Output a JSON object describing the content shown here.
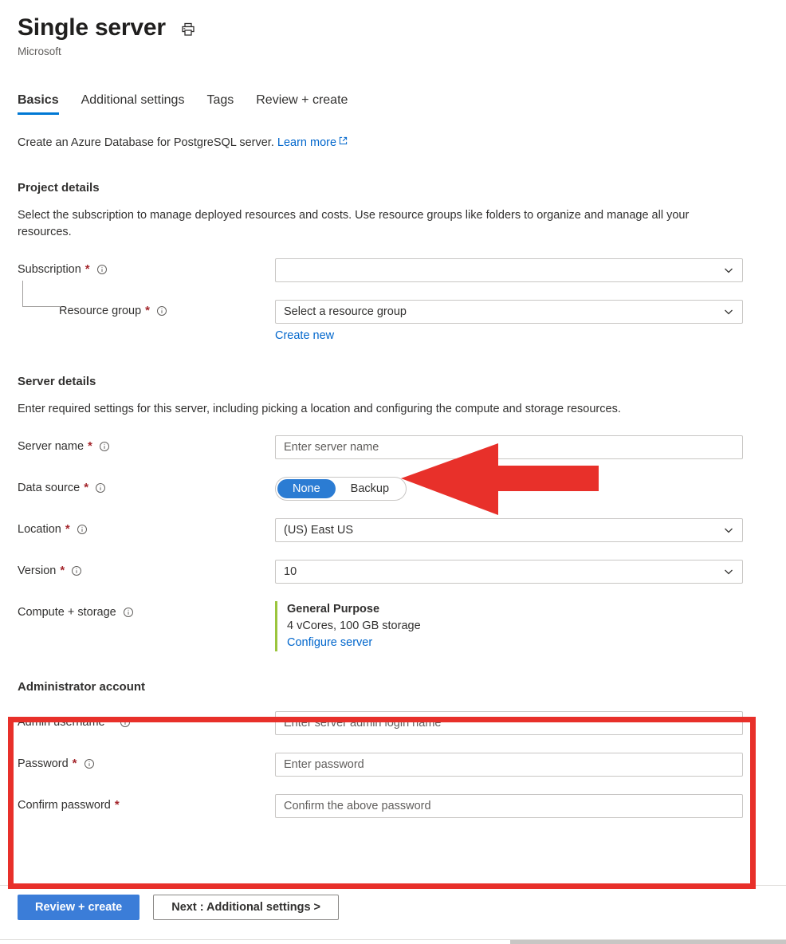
{
  "header": {
    "title": "Single server",
    "publisher": "Microsoft",
    "print_icon": "printer-icon"
  },
  "tabs": [
    {
      "label": "Basics",
      "active": true
    },
    {
      "label": "Additional settings",
      "active": false
    },
    {
      "label": "Tags",
      "active": false
    },
    {
      "label": "Review + create",
      "active": false
    }
  ],
  "intro": {
    "text": "Create an Azure Database for PostgreSQL server.",
    "link_label": "Learn more",
    "link_icon": "external-link-icon"
  },
  "project_details": {
    "heading": "Project details",
    "description": "Select the subscription to manage deployed resources and costs. Use resource groups like folders to organize and manage all your resources.",
    "subscription": {
      "label": "Subscription",
      "required": "*",
      "value": "",
      "placeholder": ""
    },
    "resource_group": {
      "label": "Resource group",
      "required": "*",
      "value": "Select a resource group",
      "create_new_label": "Create new"
    }
  },
  "server_details": {
    "heading": "Server details",
    "description": "Enter required settings for this server, including picking a location and configuring the compute and storage resources.",
    "server_name": {
      "label": "Server name",
      "required": "*",
      "value": "",
      "placeholder": "Enter server name"
    },
    "data_source": {
      "label": "Data source",
      "required": "*",
      "options": [
        "None",
        "Backup"
      ],
      "selected": "None"
    },
    "location": {
      "label": "Location",
      "required": "*",
      "value": "(US) East US"
    },
    "version": {
      "label": "Version",
      "required": "*",
      "value": "10"
    },
    "compute_storage": {
      "label": "Compute + storage",
      "required": "",
      "tier": "General Purpose",
      "specs": "4 vCores, 100 GB storage",
      "configure_link": "Configure server",
      "accent_color": "#9bc53d"
    }
  },
  "administrator_account": {
    "heading": "Administrator account",
    "admin_username": {
      "label": "Admin username",
      "required": "*",
      "value": "",
      "placeholder": "Enter server admin login name"
    },
    "password": {
      "label": "Password",
      "required": "*",
      "value": "",
      "placeholder": "Enter password"
    },
    "confirm_password": {
      "label": "Confirm password",
      "required": "*",
      "value": "",
      "placeholder": "Confirm the above password"
    }
  },
  "footer": {
    "review_create_label": "Review + create",
    "next_label": "Next : Additional settings >"
  },
  "annotations": {
    "highlight_color": "#e8302a",
    "arrow_target": "server-name-input",
    "box_target": "administrator-account-section"
  },
  "colors": {
    "accent_blue": "#0078d4",
    "link_blue": "#0066cc",
    "toggle_blue": "#2b7cd3",
    "required_red": "#a4262c",
    "annotation_red": "#e8302a",
    "compute_green": "#9bc53d"
  }
}
